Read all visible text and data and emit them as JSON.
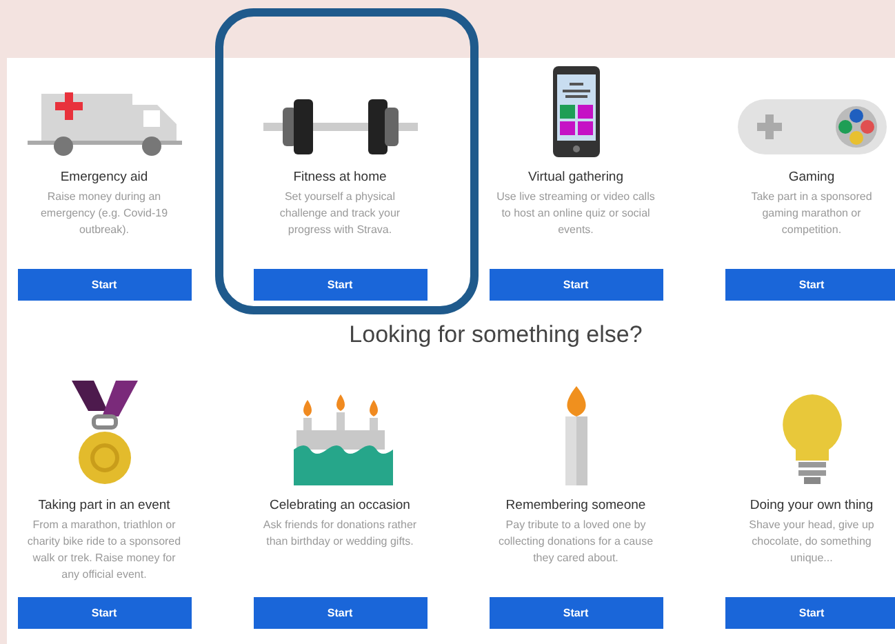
{
  "top_cards": [
    {
      "title": "Emergency aid",
      "description": "Raise money during an emergency (e.g. Covid-19 outbreak).",
      "button": "Start",
      "highlighted": false
    },
    {
      "title": "Fitness at home",
      "description": "Set yourself a physical challenge and track your progress with Strava.",
      "button": "Start",
      "highlighted": true
    },
    {
      "title": "Virtual gathering",
      "description": "Use live streaming or video calls to host an online quiz or social events.",
      "button": "Start",
      "highlighted": false
    },
    {
      "title": "Gaming",
      "description": "Take part in a sponsored gaming marathon or competition.",
      "button": "Start",
      "highlighted": false
    }
  ],
  "heading": "Looking for something else?",
  "bottom_cards": [
    {
      "title": "Taking part in an event",
      "description": "From a marathon, triathlon or charity bike ride to a sponsored walk or trek. Raise money for any official event.",
      "button": "Start",
      "highlighted": false
    },
    {
      "title": "Celebrating an occasion",
      "description": "Ask friends for donations rather than birthday or wedding gifts.",
      "button": "Start",
      "highlighted": false
    },
    {
      "title": "Remembering someone",
      "description": "Pay tribute to a loved one by collecting donations for a cause they cared about.",
      "button": "Start",
      "highlighted": false
    },
    {
      "title": "Doing your own thing",
      "description": "Shave your head, give up chocolate, do something unique...",
      "button": "Start",
      "highlighted": false
    }
  ]
}
